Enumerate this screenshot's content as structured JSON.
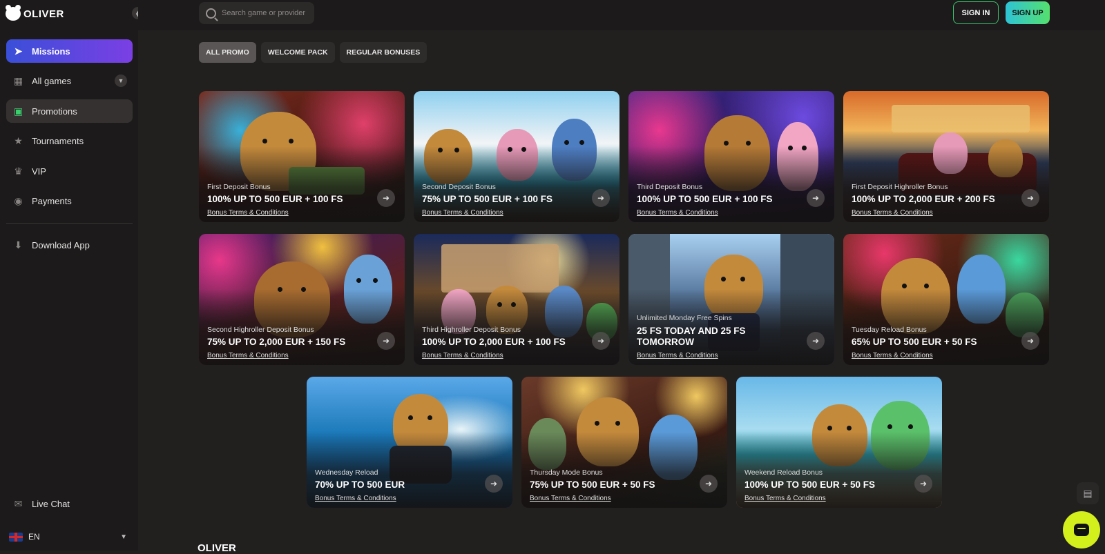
{
  "brand": {
    "name": "OLIVER"
  },
  "sidebar": {
    "items": [
      {
        "label": "Missions",
        "icon": "rocket-icon"
      },
      {
        "label": "All games",
        "icon": "games-icon"
      },
      {
        "label": "Promotions",
        "icon": "gift-icon"
      },
      {
        "label": "Tournaments",
        "icon": "trophy-icon"
      },
      {
        "label": "VIP",
        "icon": "crown-icon"
      },
      {
        "label": "Payments",
        "icon": "coin-icon"
      },
      {
        "label": "Download App",
        "icon": "download-icon"
      },
      {
        "label": "Live Chat",
        "icon": "chat-icon"
      }
    ],
    "language": "EN"
  },
  "header": {
    "search_placeholder": "Search game or provider",
    "signin_label": "SIGN IN",
    "signup_label": "SIGN UP"
  },
  "filters": [
    "ALL PROMO",
    "WELCOME PACK",
    "REGULAR BONUSES"
  ],
  "promos": [
    {
      "subtitle": "First Deposit Bonus",
      "headline": "100% UP TO 500 EUR + 100 FS",
      "terms": "Bonus Terms & Conditions"
    },
    {
      "subtitle": "Second Deposit Bonus",
      "headline": "75% UP TO 500 EUR + 100 FS",
      "terms": "Bonus Terms & Conditions"
    },
    {
      "subtitle": "Third Deposit Bonus",
      "headline": "100% UP TO 500 EUR + 100 FS",
      "terms": "Bonus Terms & Conditions"
    },
    {
      "subtitle": "First Deposit Highroller Bonus",
      "headline": "100% UP TO 2,000 EUR + 200 FS",
      "terms": "Bonus Terms & Conditions"
    },
    {
      "subtitle": "Second Highroller Deposit Bonus",
      "headline": "75% UP TO 2,000 EUR + 150 FS",
      "terms": "Bonus Terms & Conditions"
    },
    {
      "subtitle": "Third Highroller Deposit Bonus",
      "headline": "100% UP TO 2,000 EUR + 100 FS",
      "terms": "Bonus Terms & Conditions"
    },
    {
      "subtitle": "Unlimited Monday Free Spins",
      "headline": "25 FS TODAY AND 25 FS TOMORROW",
      "terms": "Bonus Terms & Conditions"
    },
    {
      "subtitle": "Tuesday Reload Bonus",
      "headline": "65% UP TO 500 EUR + 50 FS",
      "terms": "Bonus Terms & Conditions"
    },
    {
      "subtitle": "Wednesday Reload",
      "headline": "70% UP TO 500 EUR",
      "terms": "Bonus Terms & Conditions"
    },
    {
      "subtitle": "Thursday Mode Bonus",
      "headline": "75% UP TO 500 EUR + 50 FS",
      "terms": "Bonus Terms & Conditions"
    },
    {
      "subtitle": "Weekend Reload Bonus",
      "headline": "100% UP TO 500 EUR + 50 FS",
      "terms": "Bonus Terms & Conditions"
    }
  ],
  "colors": {
    "accent_green": "#39c66f",
    "chat_button": "#d4f01c",
    "missions_gradient_start": "#3a4fd8",
    "missions_gradient_end": "#7b3fe4"
  }
}
